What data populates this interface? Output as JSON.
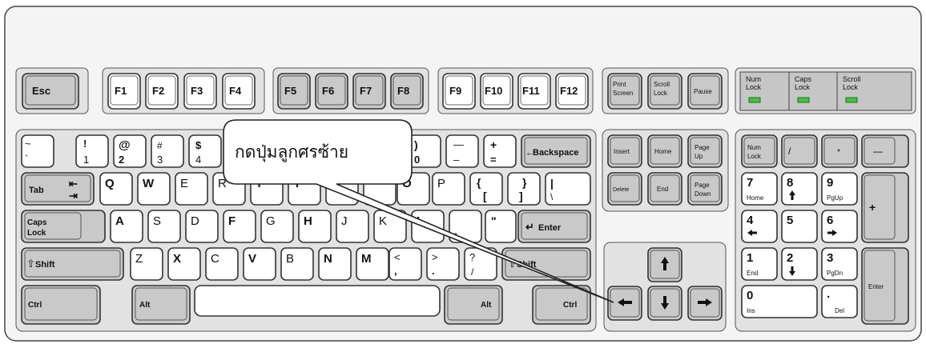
{
  "callout": {
    "text": "กดปุ่มลูกศรซ้าย"
  },
  "colors": {
    "board": "#f2f2f2",
    "group": "#e0e0e0",
    "key_light": "#ffffff",
    "key_dark": "#c9c9c9",
    "led_panel": "#c4c4c4",
    "led": "#3cc43c",
    "outline": "#333333"
  },
  "function_row": {
    "esc": "Esc",
    "f1": "F1",
    "f2": "F2",
    "f3": "F3",
    "f4": "F4",
    "f5": "F5",
    "f6": "F6",
    "f7": "F7",
    "f8": "F8",
    "f9": "F9",
    "f10": "F10",
    "f11": "F11",
    "f12": "F12"
  },
  "system_keys": {
    "print_1": "Print",
    "print_2": "Screen",
    "scroll_1": "Scroll",
    "scroll_2": "Lock",
    "pause": "Pause"
  },
  "leds": {
    "num_1": "Num",
    "num_2": "Lock",
    "caps_1": "Caps",
    "caps_2": "Lock",
    "scroll_1": "Scroll",
    "scroll_2": "Lock"
  },
  "number_row": {
    "tilde_top": "~",
    "tilde_bot": "`",
    "k1_top": "!",
    "k1_bot": "1",
    "k2_top": "@",
    "k2_bot": "2",
    "k3_top": "#",
    "k3_bot": "3",
    "k4_top": "$",
    "k4_bot": "4",
    "k0_top": ")",
    "k0_bot": "0",
    "minus_top": "—",
    "minus_bot": "–",
    "plus_top": "+",
    "plus_bot": "=",
    "backspace": "Backspace"
  },
  "letter_rows": {
    "tab": "Tab",
    "q": "Q",
    "w": "W",
    "e": "E",
    "r": "R",
    "t": "T",
    "y": "Y",
    "u": "U",
    "o": "O",
    "p": "P",
    "lbrace_top": "{",
    "lbrace_bot": "[",
    "rbrace_top": "}",
    "rbrace_bot": "]",
    "pipe_top": "|",
    "pipe_bot": "\\",
    "caps_1": "Caps",
    "caps_2": "Lock",
    "a": "A",
    "s": "S",
    "d": "D",
    "f": "F",
    "g": "G",
    "h": "H",
    "j": "J",
    "k": "K",
    "l": "L",
    "semi_bot": ";",
    "quote_top": "\"",
    "enter": "Enter",
    "shift_left": "Shift",
    "z": "Z",
    "x": "X",
    "c": "C",
    "v": "V",
    "b": "B",
    "n": "N",
    "m": "M",
    "lt_top": "<",
    "lt_bot": ",",
    "gt_top": ">",
    "gt_bot": ".",
    "q_top": "?",
    "q_bot": "/",
    "shift_right": "Shift"
  },
  "bottom_row": {
    "ctrl_left": "Ctrl",
    "alt_left": "Alt",
    "alt_right": "Alt",
    "ctrl_right": "Ctrl"
  },
  "nav_cluster": {
    "insert": "Insert",
    "home": "Home",
    "pgup_1": "Page",
    "pgup_2": "Up",
    "delete": "Delete",
    "end": "End",
    "pgdn_1": "Page",
    "pgdn_2": "Down"
  },
  "numpad": {
    "num_1": "Num",
    "num_2": "Lock",
    "slash": "/",
    "star": "*",
    "minus": "—",
    "k7": "7",
    "k7_sub": "Home",
    "k8": "8",
    "k9": "9",
    "k9_sub": "PgUp",
    "plus": "+",
    "k4": "4",
    "k5": "5",
    "k6": "6",
    "k1": "1",
    "k1_sub": "End",
    "k2": "2",
    "k3": "3",
    "k3_sub": "PgDn",
    "enter": "Enter",
    "k0": "0",
    "k0_sub": "Ins",
    "dot": ".",
    "dot_sub": "Del"
  }
}
